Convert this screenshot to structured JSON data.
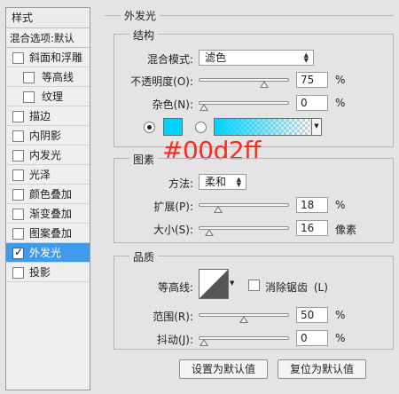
{
  "sidebar": {
    "header": "样式",
    "blend_default": "混合选项:默认",
    "items": [
      {
        "label": "斜面和浮雕",
        "checked": false
      },
      {
        "label": "等高线",
        "checked": false
      },
      {
        "label": "纹理",
        "checked": false
      },
      {
        "label": "描边",
        "checked": false
      },
      {
        "label": "内阴影",
        "checked": false
      },
      {
        "label": "内发光",
        "checked": false
      },
      {
        "label": "光泽",
        "checked": false
      },
      {
        "label": "颜色叠加",
        "checked": false
      },
      {
        "label": "渐变叠加",
        "checked": false
      },
      {
        "label": "图案叠加",
        "checked": false
      },
      {
        "label": "外发光",
        "checked": true
      },
      {
        "label": "投影",
        "checked": false
      }
    ],
    "check_glyph": "✓"
  },
  "panel": {
    "title": "外发光",
    "structure": {
      "title": "结构",
      "blend_mode_label": "混合模式:",
      "blend_mode_value": "滤色",
      "opacity_label": "不透明度(O):",
      "opacity_value": "75",
      "opacity_unit": "%",
      "opacity_level": 0.75,
      "noise_label": "杂色(N):",
      "noise_value": "0",
      "noise_unit": "%",
      "noise_level": 0,
      "glow_color": "#00d2ff",
      "annotation": "#00d2ff"
    },
    "elements": {
      "title": "图素",
      "technique_label": "方法:",
      "technique_value": "柔和",
      "spread_label": "扩展(P):",
      "spread_value": "18",
      "spread_unit": "%",
      "spread_level": 0.18,
      "size_label": "大小(S):",
      "size_value": "16",
      "size_unit": "像素",
      "size_level": 0.065
    },
    "quality": {
      "title": "品质",
      "contour_label": "等高线:",
      "antialias_label": "消除锯齿",
      "antialias_shortcut": "(L)",
      "range_label": "范围(R):",
      "range_value": "50",
      "range_unit": "%",
      "range_level": 0.5,
      "jitter_label": "抖动(J):",
      "jitter_value": "0",
      "jitter_unit": "%",
      "jitter_level": 0
    },
    "buttons": {
      "make_default": "设置为默认值",
      "reset_default": "复位为默认值"
    }
  }
}
